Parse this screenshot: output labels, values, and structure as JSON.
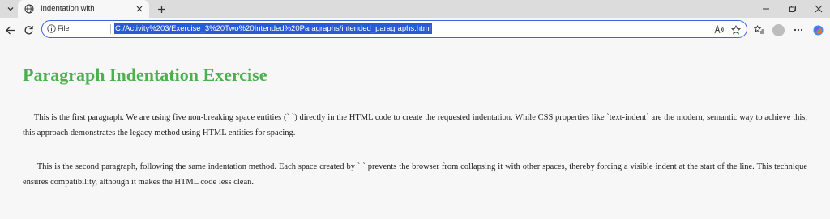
{
  "browser": {
    "tab": {
      "title": "Indentation with"
    },
    "address_bar": {
      "scheme_label": "File",
      "url": "C:/Activity%203/Exercise_3%20Two%20Intended%20Paragraphs/intended_paragraphs.html"
    }
  },
  "page": {
    "title": "Paragraph Indentation Exercise",
    "paragraphs": [
      "This is the first paragraph. We are using five non-breaking space entities (` `) directly in the HTML code to create the requested indentation. While CSS properties like `text-indent` are the modern, semantic way to achieve this, this approach demonstrates the legacy method using HTML entities for spacing.",
      "This is the second paragraph, following the same indentation method. Each space created by ` ` prevents the browser from collapsing it with other spaces, thereby forcing a visible indent at the start of the line. This technique ensures compatibility, although it makes the HTML code less clean."
    ]
  },
  "colors": {
    "title_green": "#4caf50",
    "omnibox_border": "#3a64d8",
    "url_selection": "#2a5bd7"
  }
}
